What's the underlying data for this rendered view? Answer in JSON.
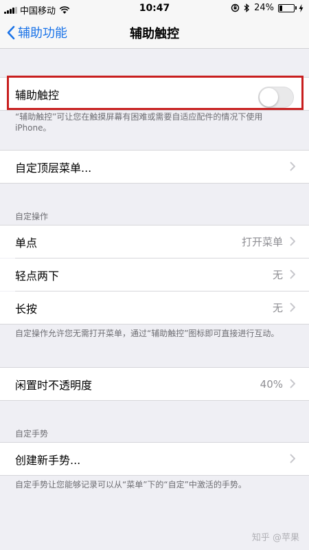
{
  "status_bar": {
    "carrier": "中国移动",
    "time": "10:47",
    "battery_percent": "24%",
    "battery_level": 0.24
  },
  "nav": {
    "back_label": "辅助功能",
    "title": "辅助触控"
  },
  "assistive_touch": {
    "label": "辅助触控",
    "toggle_on": false,
    "description": "“辅助触控”可让您在触摸屏幕有困难或需要自适应配件的情况下使用 iPhone。"
  },
  "top_menu": {
    "label": "自定顶层菜单..."
  },
  "custom_actions": {
    "header": "自定操作",
    "items": [
      {
        "label": "单点",
        "value": "打开菜单"
      },
      {
        "label": "轻点两下",
        "value": "无"
      },
      {
        "label": "长按",
        "value": "无"
      }
    ],
    "footer": "自定操作允许您无需打开菜单，通过“辅助触控”图标即可直接进行互动。"
  },
  "idle_opacity": {
    "label": "闲置时不透明度",
    "value": "40%"
  },
  "custom_gestures": {
    "header": "自定手势",
    "create_label": "创建新手势...",
    "footer": "自定手势让您能够记录可以从“菜单”下的“自定”中激活的手势。"
  },
  "watermark": "知乎 @苹果",
  "colors": {
    "accent": "#1a73e8",
    "highlight_border": "#c81e1e",
    "background": "#efeff4"
  }
}
